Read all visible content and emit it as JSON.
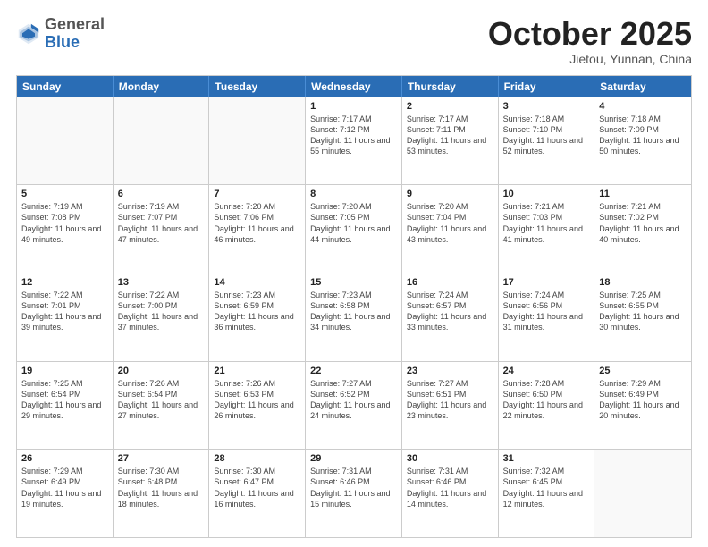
{
  "header": {
    "logo_general": "General",
    "logo_blue": "Blue",
    "month_title": "October 2025",
    "location": "Jietou, Yunnan, China"
  },
  "days_of_week": [
    "Sunday",
    "Monday",
    "Tuesday",
    "Wednesday",
    "Thursday",
    "Friday",
    "Saturday"
  ],
  "weeks": [
    [
      {
        "day": "",
        "info": ""
      },
      {
        "day": "",
        "info": ""
      },
      {
        "day": "",
        "info": ""
      },
      {
        "day": "1",
        "info": "Sunrise: 7:17 AM\nSunset: 7:12 PM\nDaylight: 11 hours and 55 minutes."
      },
      {
        "day": "2",
        "info": "Sunrise: 7:17 AM\nSunset: 7:11 PM\nDaylight: 11 hours and 53 minutes."
      },
      {
        "day": "3",
        "info": "Sunrise: 7:18 AM\nSunset: 7:10 PM\nDaylight: 11 hours and 52 minutes."
      },
      {
        "day": "4",
        "info": "Sunrise: 7:18 AM\nSunset: 7:09 PM\nDaylight: 11 hours and 50 minutes."
      }
    ],
    [
      {
        "day": "5",
        "info": "Sunrise: 7:19 AM\nSunset: 7:08 PM\nDaylight: 11 hours and 49 minutes."
      },
      {
        "day": "6",
        "info": "Sunrise: 7:19 AM\nSunset: 7:07 PM\nDaylight: 11 hours and 47 minutes."
      },
      {
        "day": "7",
        "info": "Sunrise: 7:20 AM\nSunset: 7:06 PM\nDaylight: 11 hours and 46 minutes."
      },
      {
        "day": "8",
        "info": "Sunrise: 7:20 AM\nSunset: 7:05 PM\nDaylight: 11 hours and 44 minutes."
      },
      {
        "day": "9",
        "info": "Sunrise: 7:20 AM\nSunset: 7:04 PM\nDaylight: 11 hours and 43 minutes."
      },
      {
        "day": "10",
        "info": "Sunrise: 7:21 AM\nSunset: 7:03 PM\nDaylight: 11 hours and 41 minutes."
      },
      {
        "day": "11",
        "info": "Sunrise: 7:21 AM\nSunset: 7:02 PM\nDaylight: 11 hours and 40 minutes."
      }
    ],
    [
      {
        "day": "12",
        "info": "Sunrise: 7:22 AM\nSunset: 7:01 PM\nDaylight: 11 hours and 39 minutes."
      },
      {
        "day": "13",
        "info": "Sunrise: 7:22 AM\nSunset: 7:00 PM\nDaylight: 11 hours and 37 minutes."
      },
      {
        "day": "14",
        "info": "Sunrise: 7:23 AM\nSunset: 6:59 PM\nDaylight: 11 hours and 36 minutes."
      },
      {
        "day": "15",
        "info": "Sunrise: 7:23 AM\nSunset: 6:58 PM\nDaylight: 11 hours and 34 minutes."
      },
      {
        "day": "16",
        "info": "Sunrise: 7:24 AM\nSunset: 6:57 PM\nDaylight: 11 hours and 33 minutes."
      },
      {
        "day": "17",
        "info": "Sunrise: 7:24 AM\nSunset: 6:56 PM\nDaylight: 11 hours and 31 minutes."
      },
      {
        "day": "18",
        "info": "Sunrise: 7:25 AM\nSunset: 6:55 PM\nDaylight: 11 hours and 30 minutes."
      }
    ],
    [
      {
        "day": "19",
        "info": "Sunrise: 7:25 AM\nSunset: 6:54 PM\nDaylight: 11 hours and 29 minutes."
      },
      {
        "day": "20",
        "info": "Sunrise: 7:26 AM\nSunset: 6:54 PM\nDaylight: 11 hours and 27 minutes."
      },
      {
        "day": "21",
        "info": "Sunrise: 7:26 AM\nSunset: 6:53 PM\nDaylight: 11 hours and 26 minutes."
      },
      {
        "day": "22",
        "info": "Sunrise: 7:27 AM\nSunset: 6:52 PM\nDaylight: 11 hours and 24 minutes."
      },
      {
        "day": "23",
        "info": "Sunrise: 7:27 AM\nSunset: 6:51 PM\nDaylight: 11 hours and 23 minutes."
      },
      {
        "day": "24",
        "info": "Sunrise: 7:28 AM\nSunset: 6:50 PM\nDaylight: 11 hours and 22 minutes."
      },
      {
        "day": "25",
        "info": "Sunrise: 7:29 AM\nSunset: 6:49 PM\nDaylight: 11 hours and 20 minutes."
      }
    ],
    [
      {
        "day": "26",
        "info": "Sunrise: 7:29 AM\nSunset: 6:49 PM\nDaylight: 11 hours and 19 minutes."
      },
      {
        "day": "27",
        "info": "Sunrise: 7:30 AM\nSunset: 6:48 PM\nDaylight: 11 hours and 18 minutes."
      },
      {
        "day": "28",
        "info": "Sunrise: 7:30 AM\nSunset: 6:47 PM\nDaylight: 11 hours and 16 minutes."
      },
      {
        "day": "29",
        "info": "Sunrise: 7:31 AM\nSunset: 6:46 PM\nDaylight: 11 hours and 15 minutes."
      },
      {
        "day": "30",
        "info": "Sunrise: 7:31 AM\nSunset: 6:46 PM\nDaylight: 11 hours and 14 minutes."
      },
      {
        "day": "31",
        "info": "Sunrise: 7:32 AM\nSunset: 6:45 PM\nDaylight: 11 hours and 12 minutes."
      },
      {
        "day": "",
        "info": ""
      }
    ]
  ]
}
